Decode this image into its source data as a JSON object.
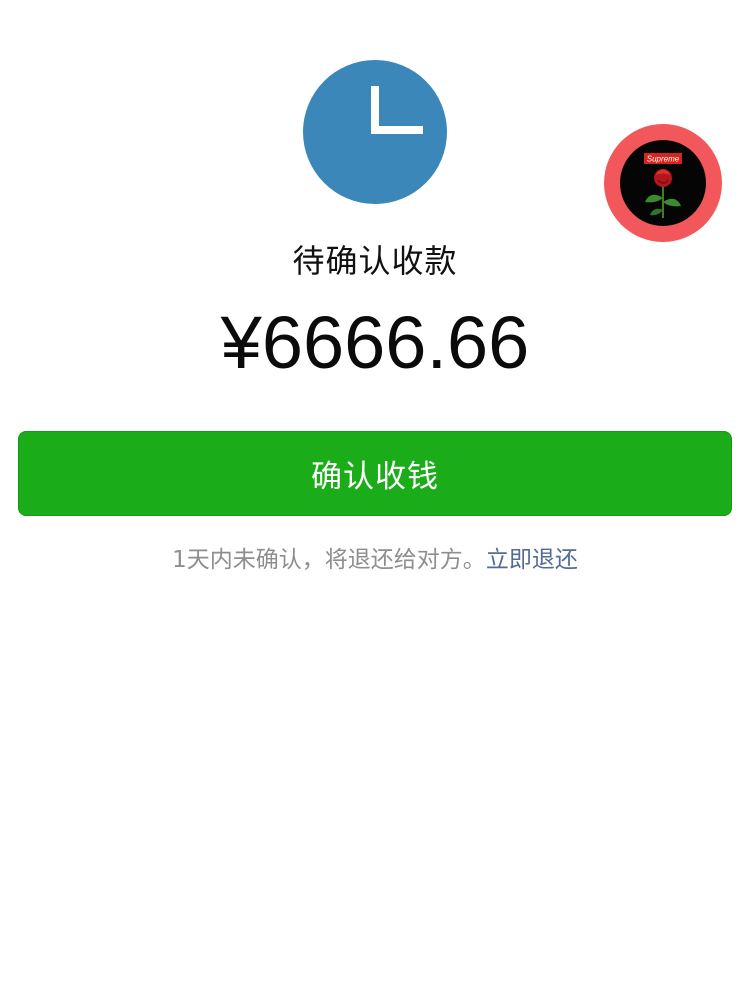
{
  "status": {
    "icon": "clock-icon",
    "icon_color": "#3b87ba",
    "title": "待确认收款"
  },
  "amount": {
    "value": "¥6666.66"
  },
  "avatar": {
    "ring_color": "#f2585b",
    "badge_text": "Supreme",
    "icon": "rose-icon"
  },
  "actions": {
    "confirm_label": "确认收钱",
    "confirm_color": "#1aad19"
  },
  "note": {
    "text": "1天内未确认，将退还给对方。",
    "link_label": "立即退还",
    "link_color": "#566b94"
  }
}
